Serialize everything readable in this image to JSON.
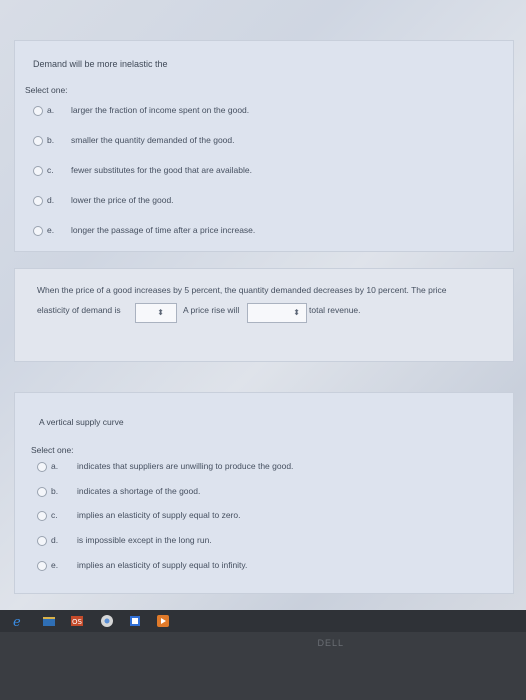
{
  "question1": {
    "stem": "Demand will be more inelastic the",
    "select_one": "Select one:",
    "options": [
      {
        "letter": "a.",
        "text": "larger the fraction of income spent on the good."
      },
      {
        "letter": "b.",
        "text": "smaller the quantity demanded of the good."
      },
      {
        "letter": "c.",
        "text": "fewer substitutes for the good that are available."
      },
      {
        "letter": "d.",
        "text": "lower the price of the good."
      },
      {
        "letter": "e.",
        "text": "longer the passage of time after a price increase."
      }
    ]
  },
  "question2": {
    "line1": "When the price of a good increases by 5 percent, the quantity demanded decreases by 10 percent. The price",
    "line2_prefix": "elasticity of demand is",
    "dropdown_arrow": "⬍",
    "middle": "A price rise will",
    "suffix": "total revenue."
  },
  "question3": {
    "stem": "A vertical supply curve",
    "select_one": "Select one:",
    "options": [
      {
        "letter": "a.",
        "text": "indicates that suppliers are unwilling to produce the good."
      },
      {
        "letter": "b.",
        "text": "indicates a shortage of the good."
      },
      {
        "letter": "c.",
        "text": "implies an elasticity of supply equal to zero."
      },
      {
        "letter": "d.",
        "text": "is impossible except in the long run."
      },
      {
        "letter": "e.",
        "text": "implies an elasticity of supply equal to infinity."
      }
    ]
  },
  "taskbar": {
    "brand": "DELL",
    "icons": [
      "edge-icon",
      "file-explorer-icon",
      "office-icon",
      "chrome-icon",
      "outlook-icon",
      "media-icon"
    ]
  }
}
